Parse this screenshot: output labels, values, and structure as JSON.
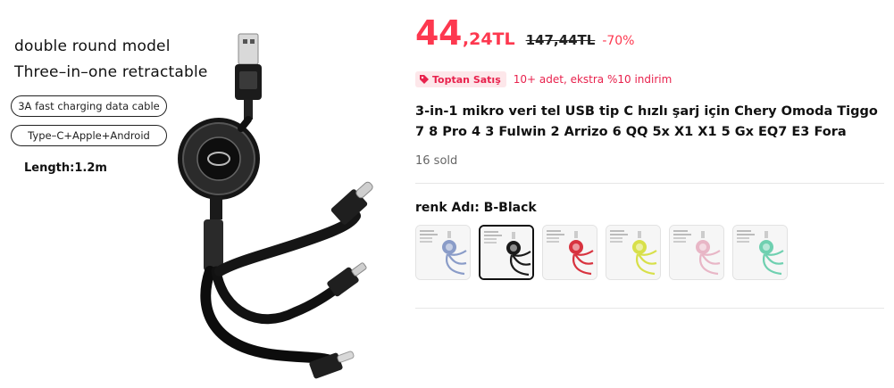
{
  "image": {
    "line1": "double round model",
    "line2": "Three–in–one retractable",
    "pill1": "3A fast charging data cable",
    "pill2": "Type–C+Apple+Android",
    "length": "Length:1.2m"
  },
  "price": {
    "integer": "44",
    "decimal": ",24TL",
    "original": "147,44TL",
    "discount": "-70%",
    "accent_color": "#fd384f"
  },
  "wholesale": {
    "badge": "Toptan Satış",
    "text": "10+ adet, ekstra %10 indirim",
    "icon": "tag-icon"
  },
  "product": {
    "title": "3-in-1 mikro veri tel USB tip C hızlı şarj için Chery Omoda Tiggo 7 8 Pro 4 3 Fulwin 2 Arrizo 6 QQ 5x X1 X1 5 Gx EQ7 E3 Fora",
    "sold": "16 sold"
  },
  "color": {
    "label": "renk Adı: B-Black",
    "selected": "B-Black",
    "swatches": [
      {
        "cable": "#8a9cc8"
      },
      {
        "cable": "#1a1a1a"
      },
      {
        "cable": "#d8333f"
      },
      {
        "cable": "#d8e04a"
      },
      {
        "cable": "#e8b6c6"
      },
      {
        "cable": "#6fd0b0"
      }
    ]
  }
}
